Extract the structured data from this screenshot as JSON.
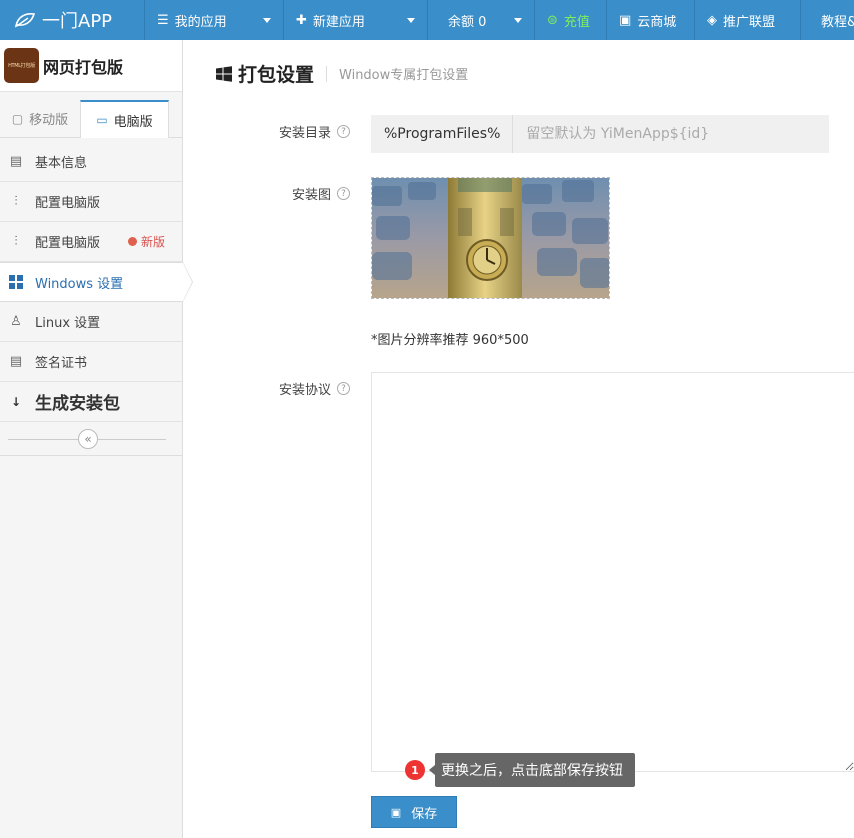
{
  "topbar": {
    "logo_text": "一门APP",
    "nav": {
      "my_apps": "我的应用",
      "new_app": "新建应用",
      "balance": "余额 0",
      "recharge": "充值",
      "cloud_store": "云商城",
      "affiliate": "推广联盟",
      "tutorial": "教程&"
    },
    "colors": {
      "bar": "#3a8ec9",
      "recharge": "#7ff05a"
    }
  },
  "sidebar": {
    "app_logo_text": "HTML打包版",
    "app_title": "网页打包版",
    "tabs": {
      "mobile": "移动版",
      "desktop": "电脑版"
    },
    "menu": {
      "basic_info": "基本信息",
      "config_pc": "配置电脑版",
      "config_pc_new": "配置电脑版",
      "new_tag": "新版",
      "windows": "Windows 设置",
      "linux": "Linux 设置",
      "cert": "签名证书",
      "build": "生成安装包"
    },
    "collapse_glyph": "«"
  },
  "main": {
    "title": "打包设置",
    "subtitle": "Window专属打包设置",
    "install_dir": {
      "label": "安装目录",
      "prefix": "%ProgramFiles%",
      "placeholder": "留空默认为 YiMenApp${id}"
    },
    "install_image": {
      "label": "安装图",
      "hint": "*图片分辨率推荐 960*500"
    },
    "agreement": {
      "label": "安装协议"
    },
    "tooltip": {
      "badge": "1",
      "text": "更换之后，点击底部保存按钮"
    },
    "save_button": "保存"
  }
}
